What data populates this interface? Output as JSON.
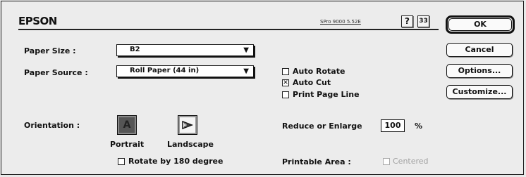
{
  "header": {
    "brand": "EPSON",
    "version": "SPro 9000 5.52E",
    "help_label": "?",
    "info_label": "33"
  },
  "buttons": {
    "ok": "OK",
    "cancel": "Cancel",
    "options": "Options...",
    "customize": "Customize..."
  },
  "paper_size": {
    "label": "Paper Size :",
    "value": "B2"
  },
  "paper_source": {
    "label": "Paper Source :",
    "value": "Roll Paper (44 in)"
  },
  "checkboxes": {
    "auto_rotate": {
      "label": "Auto Rotate",
      "checked": false
    },
    "auto_cut": {
      "label": "Auto Cut",
      "checked": true
    },
    "print_page_line": {
      "label": "Print Page Line",
      "checked": false
    },
    "rotate_180": {
      "label": "Rotate by 180 degree",
      "checked": false
    },
    "centered": {
      "label": "Centered",
      "checked": false,
      "enabled": false
    }
  },
  "orientation": {
    "label": "Orientation :",
    "portrait": "Portrait",
    "landscape": "Landscape",
    "selected": "Portrait"
  },
  "reduce_enlarge": {
    "label": "Reduce or Enlarge",
    "value": "100",
    "unit": "%"
  },
  "printable_area": {
    "label": "Printable Area :"
  }
}
